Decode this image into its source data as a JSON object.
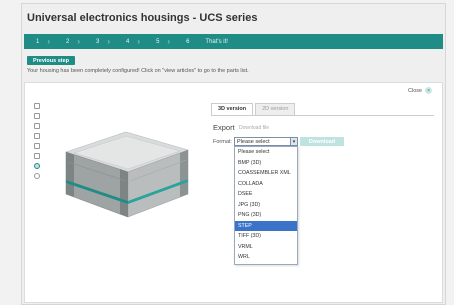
{
  "window": {
    "title": "Universal electronics housings - UCS series"
  },
  "steps": [
    {
      "label": "1"
    },
    {
      "label": "2"
    },
    {
      "label": "3"
    },
    {
      "label": "4"
    },
    {
      "label": "5"
    },
    {
      "label": "6"
    },
    {
      "label": "That's it!"
    }
  ],
  "previous_button": "Previous step",
  "info_text": "Your housing has been completely configured! Click on \"view articles\" to go to the parts list.",
  "close_label": "Close",
  "tabs": [
    {
      "label": "3D version",
      "active": true
    },
    {
      "label": "2D version",
      "active": false
    }
  ],
  "export": {
    "heading": "Export",
    "download_file_link": "Download file",
    "format_label": "Format:",
    "selected_format": "Please select",
    "download_button": "Download",
    "options": [
      "Please select",
      "BMP (3D)",
      "COASSEMBLER XML",
      "COLLADA",
      "DSEE",
      "JPG (3D)",
      "PNG (3D)",
      "STEP",
      "TIFF (3D)",
      "VRML",
      "WRL"
    ],
    "highlighted_option": "STEP"
  },
  "colors": {
    "accent": "#1f8c86",
    "highlight": "#3a73c7"
  },
  "icons": {
    "toolbar": [
      "zoom-icon",
      "pan-icon",
      "rotate-icon",
      "fit-icon",
      "view-icon",
      "measure-icon",
      "color-icon",
      "reset-icon"
    ]
  }
}
